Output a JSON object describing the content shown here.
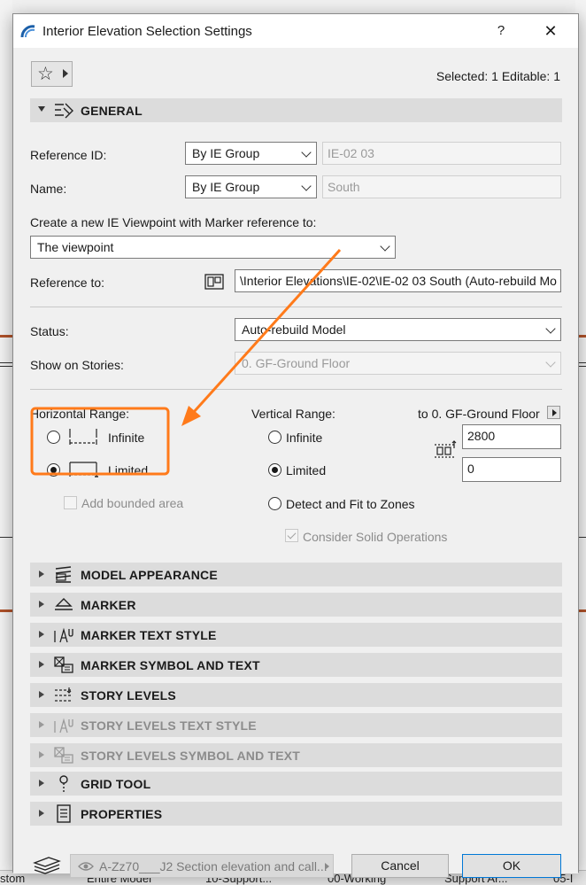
{
  "dialog": {
    "title": "Interior Elevation Selection Settings",
    "help_label": "?",
    "close_label": "✕",
    "selected_info": "Selected: 1 Editable: 1"
  },
  "general": {
    "header": "GENERAL",
    "reference_id_label": "Reference ID:",
    "reference_id_mode": "By IE Group",
    "reference_id_value": "IE-02 03",
    "name_label": "Name:",
    "name_mode": "By IE Group",
    "name_value": "South",
    "create_label": "Create a new IE Viewpoint with Marker reference to:",
    "create_value": "The viewpoint",
    "reference_to_label": "Reference to:",
    "reference_to_value": "\\Interior Elevations\\IE-02\\IE-02 03 South (Auto-rebuild Mo",
    "status_label": "Status:",
    "status_value": "Auto-rebuild Model",
    "show_on_stories_label": "Show on Stories:",
    "show_on_stories_value": "0. GF-Ground Floor"
  },
  "horizontal_range": {
    "label": "Horizontal Range:",
    "options": [
      {
        "label": "Infinite",
        "selected": false
      },
      {
        "label": "Limited",
        "selected": true
      }
    ],
    "add_bounded_area_label": "Add bounded area"
  },
  "vertical_range": {
    "label": "Vertical Range:",
    "to_story_label": "to 0. GF-Ground Floor",
    "options": [
      {
        "label": "Infinite",
        "selected": false
      },
      {
        "label": "Limited",
        "selected": true
      },
      {
        "label": "Detect and Fit to Zones",
        "selected": false
      }
    ],
    "top_value": "2800",
    "bottom_value": "0",
    "consider_solid_label": "Consider Solid Operations"
  },
  "sections": [
    {
      "label": "MODEL APPEARANCE",
      "icon": "model-appearance-icon",
      "disabled": false
    },
    {
      "label": "MARKER",
      "icon": "marker-icon",
      "disabled": false
    },
    {
      "label": "MARKER TEXT STYLE",
      "icon": "text-style-icon",
      "disabled": false
    },
    {
      "label": "MARKER SYMBOL AND TEXT",
      "icon": "symbol-text-icon",
      "disabled": false
    },
    {
      "label": "STORY LEVELS",
      "icon": "story-levels-icon",
      "disabled": false
    },
    {
      "label": "STORY LEVELS TEXT STYLE",
      "icon": "text-style-icon",
      "disabled": true
    },
    {
      "label": "STORY LEVELS SYMBOL AND TEXT",
      "icon": "symbol-text-icon",
      "disabled": true
    },
    {
      "label": "GRID TOOL",
      "icon": "grid-tool-icon",
      "disabled": false
    },
    {
      "label": "PROPERTIES",
      "icon": "properties-icon",
      "disabled": false
    }
  ],
  "footer": {
    "layer_value": "A-Zz70___J2 Section elevation and call...",
    "cancel_label": "Cancel",
    "ok_label": "OK"
  },
  "background": {
    "taskbar_items": [
      "stom",
      "Entire Model",
      "10-Support...",
      "00-Working",
      "Support Ar...",
      "05-I"
    ]
  },
  "colors": {
    "annotation": "#ff7a1a",
    "section_header": "#dcdcdc",
    "ok_border": "#0078d7"
  }
}
